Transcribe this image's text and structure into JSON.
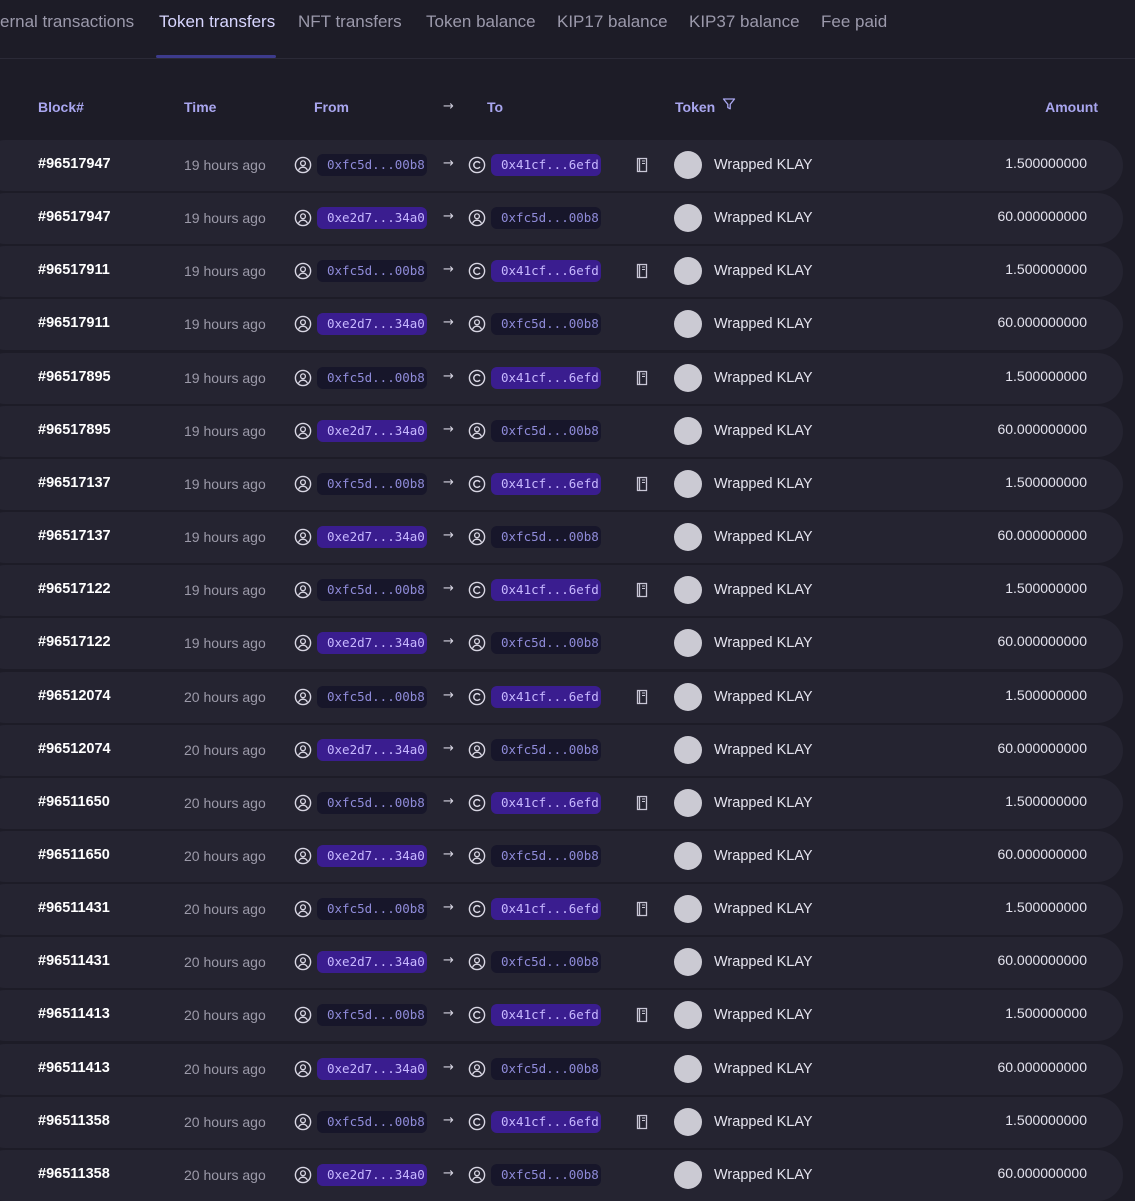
{
  "tabs": [
    {
      "label": "ernal transactions",
      "active": false
    },
    {
      "label": "Token transfers",
      "active": true
    },
    {
      "label": "NFT transfers",
      "active": false
    },
    {
      "label": "Token balance",
      "active": false
    },
    {
      "label": "KIP17 balance",
      "active": false
    },
    {
      "label": "KIP37 balance",
      "active": false
    },
    {
      "label": "Fee paid",
      "active": false
    }
  ],
  "columns": {
    "block": "Block#",
    "time": "Time",
    "from": "From",
    "arrow": "→",
    "to": "To",
    "token": "Token",
    "amount": "Amount"
  },
  "row_arrow": "→",
  "icons": {
    "from_icon": "user-circle-icon",
    "to_contract_icon": "contract-c-icon",
    "to_user_icon": "user-circle-icon",
    "book_icon": "book-icon",
    "filter_icon": "funnel-icon"
  },
  "colors": {
    "background": "#1d1c27",
    "row_background": "#252431",
    "header_text": "#a9a6ef",
    "address_purple_bg": "#3a1d8f",
    "address_dark_bg": "#17162a"
  },
  "rows": [
    {
      "block": "#96517947",
      "time": "19 hours ago",
      "from": "0xfc5d...00b8",
      "from_style": "dark",
      "to": "0x41cf...6efd",
      "to_style": "purple",
      "to_type": "contract",
      "book": true,
      "token": "Wrapped KLAY",
      "amount": "1.500000000"
    },
    {
      "block": "#96517947",
      "time": "19 hours ago",
      "from": "0xe2d7...34a0",
      "from_style": "purple",
      "to": "0xfc5d...00b8",
      "to_style": "dark",
      "to_type": "user",
      "book": false,
      "token": "Wrapped KLAY",
      "amount": "60.000000000"
    },
    {
      "block": "#96517911",
      "time": "19 hours ago",
      "from": "0xfc5d...00b8",
      "from_style": "dark",
      "to": "0x41cf...6efd",
      "to_style": "purple",
      "to_type": "contract",
      "book": true,
      "token": "Wrapped KLAY",
      "amount": "1.500000000"
    },
    {
      "block": "#96517911",
      "time": "19 hours ago",
      "from": "0xe2d7...34a0",
      "from_style": "purple",
      "to": "0xfc5d...00b8",
      "to_style": "dark",
      "to_type": "user",
      "book": false,
      "token": "Wrapped KLAY",
      "amount": "60.000000000"
    },
    {
      "block": "#96517895",
      "time": "19 hours ago",
      "from": "0xfc5d...00b8",
      "from_style": "dark",
      "to": "0x41cf...6efd",
      "to_style": "purple",
      "to_type": "contract",
      "book": true,
      "token": "Wrapped KLAY",
      "amount": "1.500000000"
    },
    {
      "block": "#96517895",
      "time": "19 hours ago",
      "from": "0xe2d7...34a0",
      "from_style": "purple",
      "to": "0xfc5d...00b8",
      "to_style": "dark",
      "to_type": "user",
      "book": false,
      "token": "Wrapped KLAY",
      "amount": "60.000000000"
    },
    {
      "block": "#96517137",
      "time": "19 hours ago",
      "from": "0xfc5d...00b8",
      "from_style": "dark",
      "to": "0x41cf...6efd",
      "to_style": "purple",
      "to_type": "contract",
      "book": true,
      "token": "Wrapped KLAY",
      "amount": "1.500000000"
    },
    {
      "block": "#96517137",
      "time": "19 hours ago",
      "from": "0xe2d7...34a0",
      "from_style": "purple",
      "to": "0xfc5d...00b8",
      "to_style": "dark",
      "to_type": "user",
      "book": false,
      "token": "Wrapped KLAY",
      "amount": "60.000000000"
    },
    {
      "block": "#96517122",
      "time": "19 hours ago",
      "from": "0xfc5d...00b8",
      "from_style": "dark",
      "to": "0x41cf...6efd",
      "to_style": "purple",
      "to_type": "contract",
      "book": true,
      "token": "Wrapped KLAY",
      "amount": "1.500000000"
    },
    {
      "block": "#96517122",
      "time": "19 hours ago",
      "from": "0xe2d7...34a0",
      "from_style": "purple",
      "to": "0xfc5d...00b8",
      "to_style": "dark",
      "to_type": "user",
      "book": false,
      "token": "Wrapped KLAY",
      "amount": "60.000000000"
    },
    {
      "block": "#96512074",
      "time": "20 hours ago",
      "from": "0xfc5d...00b8",
      "from_style": "dark",
      "to": "0x41cf...6efd",
      "to_style": "purple",
      "to_type": "contract",
      "book": true,
      "token": "Wrapped KLAY",
      "amount": "1.500000000"
    },
    {
      "block": "#96512074",
      "time": "20 hours ago",
      "from": "0xe2d7...34a0",
      "from_style": "purple",
      "to": "0xfc5d...00b8",
      "to_style": "dark",
      "to_type": "user",
      "book": false,
      "token": "Wrapped KLAY",
      "amount": "60.000000000"
    },
    {
      "block": "#96511650",
      "time": "20 hours ago",
      "from": "0xfc5d...00b8",
      "from_style": "dark",
      "to": "0x41cf...6efd",
      "to_style": "purple",
      "to_type": "contract",
      "book": true,
      "token": "Wrapped KLAY",
      "amount": "1.500000000"
    },
    {
      "block": "#96511650",
      "time": "20 hours ago",
      "from": "0xe2d7...34a0",
      "from_style": "purple",
      "to": "0xfc5d...00b8",
      "to_style": "dark",
      "to_type": "user",
      "book": false,
      "token": "Wrapped KLAY",
      "amount": "60.000000000"
    },
    {
      "block": "#96511431",
      "time": "20 hours ago",
      "from": "0xfc5d...00b8",
      "from_style": "dark",
      "to": "0x41cf...6efd",
      "to_style": "purple",
      "to_type": "contract",
      "book": true,
      "token": "Wrapped KLAY",
      "amount": "1.500000000"
    },
    {
      "block": "#96511431",
      "time": "20 hours ago",
      "from": "0xe2d7...34a0",
      "from_style": "purple",
      "to": "0xfc5d...00b8",
      "to_style": "dark",
      "to_type": "user",
      "book": false,
      "token": "Wrapped KLAY",
      "amount": "60.000000000"
    },
    {
      "block": "#96511413",
      "time": "20 hours ago",
      "from": "0xfc5d...00b8",
      "from_style": "dark",
      "to": "0x41cf...6efd",
      "to_style": "purple",
      "to_type": "contract",
      "book": true,
      "token": "Wrapped KLAY",
      "amount": "1.500000000"
    },
    {
      "block": "#96511413",
      "time": "20 hours ago",
      "from": "0xe2d7...34a0",
      "from_style": "purple",
      "to": "0xfc5d...00b8",
      "to_style": "dark",
      "to_type": "user",
      "book": false,
      "token": "Wrapped KLAY",
      "amount": "60.000000000"
    },
    {
      "block": "#96511358",
      "time": "20 hours ago",
      "from": "0xfc5d...00b8",
      "from_style": "dark",
      "to": "0x41cf...6efd",
      "to_style": "purple",
      "to_type": "contract",
      "book": true,
      "token": "Wrapped KLAY",
      "amount": "1.500000000"
    },
    {
      "block": "#96511358",
      "time": "20 hours ago",
      "from": "0xe2d7...34a0",
      "from_style": "purple",
      "to": "0xfc5d...00b8",
      "to_style": "dark",
      "to_type": "user",
      "book": false,
      "token": "Wrapped KLAY",
      "amount": "60.000000000"
    }
  ]
}
